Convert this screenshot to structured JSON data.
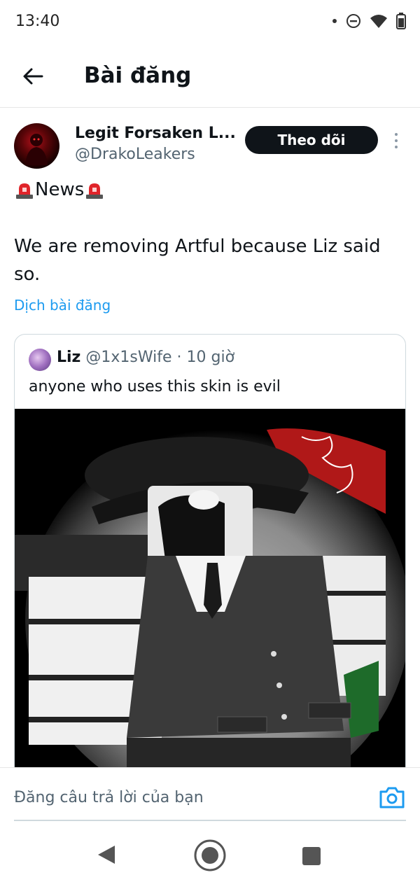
{
  "status_bar": {
    "time": "13:40",
    "icons": [
      "notification-dot-icon",
      "do-not-disturb-icon",
      "wifi-icon",
      "battery-icon"
    ]
  },
  "header": {
    "back_icon": "arrow-left-icon",
    "title": "Bài đăng"
  },
  "post": {
    "author_name": "Legit Forsaken L...",
    "author_handle": "@DrakoLeakers",
    "follow_label": "Theo dõi",
    "news_label": "News",
    "news_icon": "police-siren-emoji-icon",
    "text": "We are removing Artful because Liz said so.",
    "translate_label": "Dịch bài đăng",
    "quote": {
      "name": "Liz",
      "handle": "@1x1sWife",
      "separator": "·",
      "time": "10 giờ",
      "text": "anyone who uses this skin is evil",
      "image_description_icon": "roblox-character-image"
    }
  },
  "reply": {
    "placeholder": "Đăng câu trả lời của bạn",
    "camera_icon": "camera-icon"
  },
  "colors": {
    "link": "#1d9bf0",
    "follow_bg": "#0f1419",
    "secondary_text": "#536471",
    "border": "#cfd9de"
  }
}
